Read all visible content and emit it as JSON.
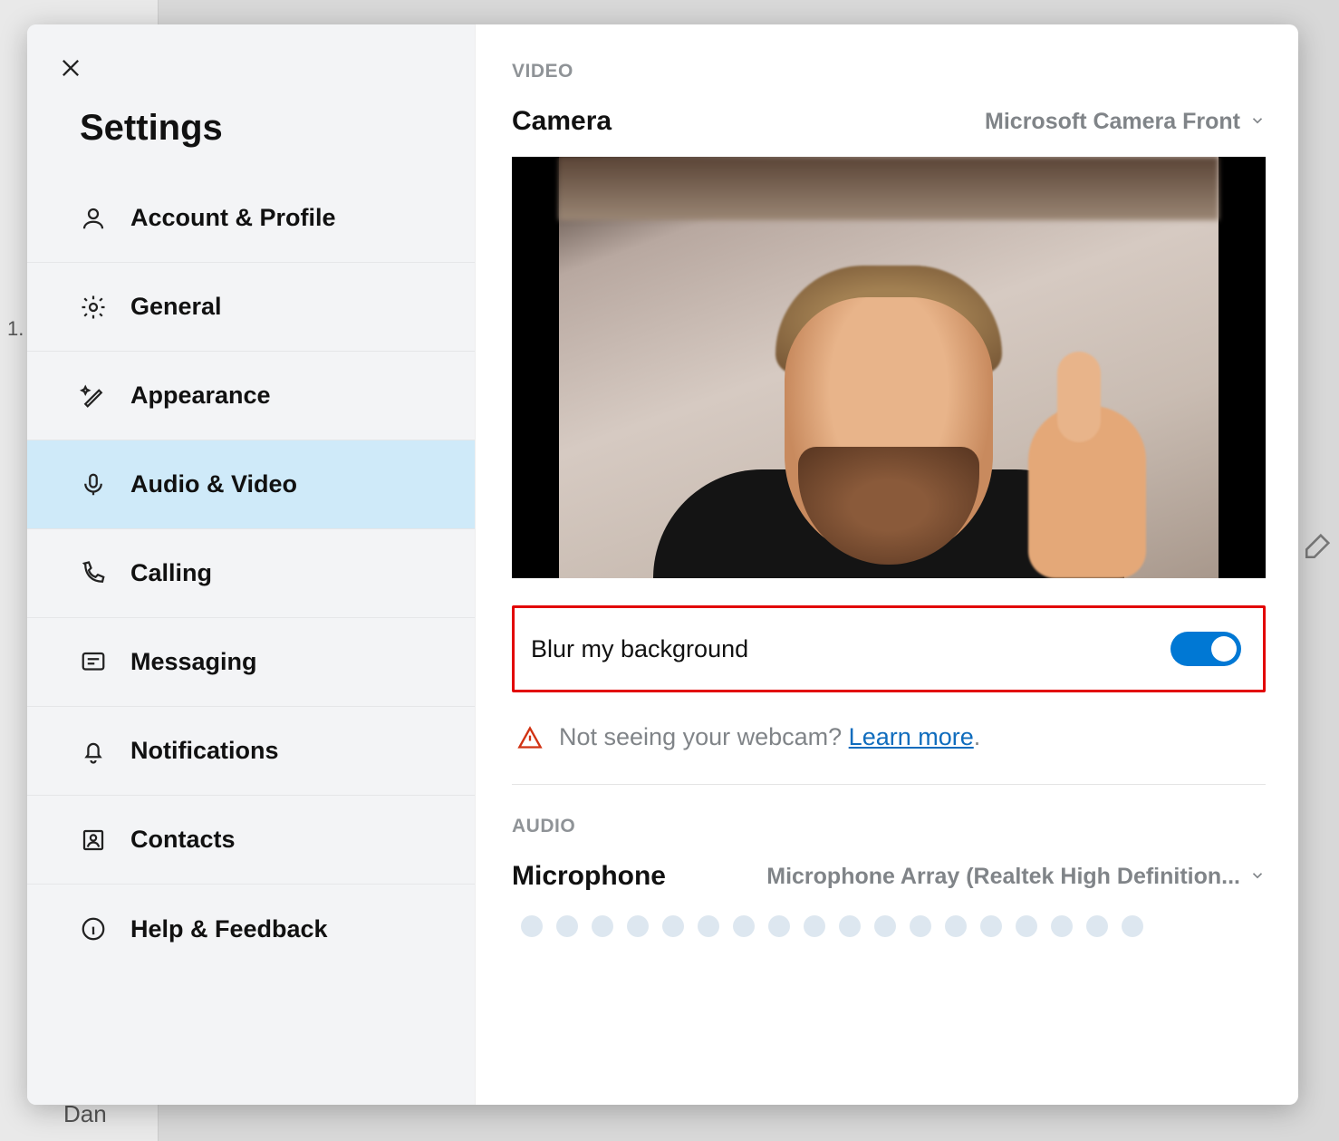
{
  "background": {
    "contact_name": "Dan",
    "sidebar_num": "1."
  },
  "sidebar": {
    "title": "Settings",
    "items": [
      {
        "label": "Account & Profile"
      },
      {
        "label": "General"
      },
      {
        "label": "Appearance"
      },
      {
        "label": "Audio & Video"
      },
      {
        "label": "Calling"
      },
      {
        "label": "Messaging"
      },
      {
        "label": "Notifications"
      },
      {
        "label": "Contacts"
      },
      {
        "label": "Help & Feedback"
      }
    ],
    "active_index": 3
  },
  "video": {
    "section_label": "VIDEO",
    "camera_label": "Camera",
    "camera_device": "Microsoft Camera Front",
    "blur_label": "Blur my background",
    "blur_on": true,
    "help_text": "Not seeing your webcam? ",
    "help_link": "Learn more",
    "help_period": "."
  },
  "audio": {
    "section_label": "AUDIO",
    "mic_label": "Microphone",
    "mic_device": "Microphone Array (Realtek High Definition...",
    "meter_dots": 18
  }
}
